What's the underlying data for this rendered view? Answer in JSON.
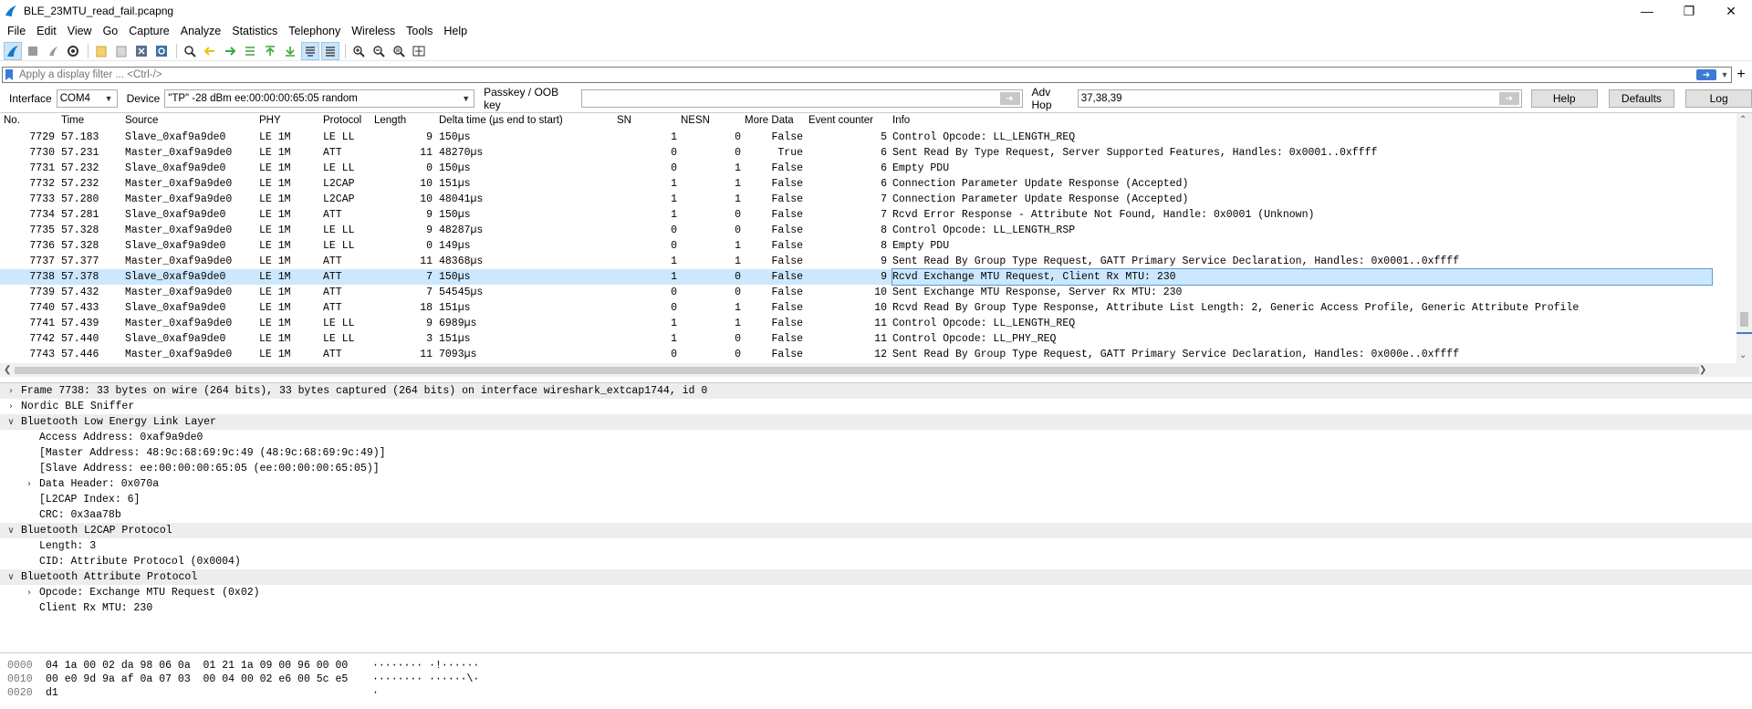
{
  "window": {
    "title": "BLE_23MTU_read_fail.pcapng"
  },
  "menu": [
    "File",
    "Edit",
    "View",
    "Go",
    "Capture",
    "Analyze",
    "Statistics",
    "Telephony",
    "Wireless",
    "Tools",
    "Help"
  ],
  "filter": {
    "placeholder": "Apply a display filter ... <Ctrl-/>"
  },
  "interface_bar": {
    "interface_label": "Interface",
    "interface_value": "COM4",
    "device_label": "Device",
    "device_value": "\"TP\" -28 dBm  ee:00:00:00:65:05  random",
    "passkey_label": "Passkey / OOB key",
    "passkey_value": "",
    "advhop_label": "Adv Hop",
    "advhop_value": "37,38,39",
    "help_button": "Help",
    "defaults_button": "Defaults",
    "log_button": "Log"
  },
  "packet_list": {
    "columns": [
      "No.",
      "Time",
      "Source",
      "PHY",
      "Protocol",
      "Length",
      "Delta time (µs end to start)",
      "SN",
      "NESN",
      "More Data",
      "Event counter",
      "Info"
    ],
    "rows": [
      {
        "no": "7729",
        "time": "57.183",
        "source": "Slave_0xaf9a9de0",
        "phy": "LE 1M",
        "protocol": "LE LL",
        "length": "9",
        "delta": "150µs",
        "sn": "1",
        "nesn": "0",
        "more": "False",
        "event": "5",
        "info": "Control Opcode: LL_LENGTH_REQ"
      },
      {
        "no": "7730",
        "time": "57.231",
        "source": "Master_0xaf9a9de0",
        "phy": "LE 1M",
        "protocol": "ATT",
        "length": "11",
        "delta": "48270µs",
        "sn": "0",
        "nesn": "0",
        "more": "True",
        "event": "6",
        "info": "Sent Read By Type Request, Server Supported Features, Handles: 0x0001..0xffff"
      },
      {
        "no": "7731",
        "time": "57.232",
        "source": "Slave_0xaf9a9de0",
        "phy": "LE 1M",
        "protocol": "LE LL",
        "length": "0",
        "delta": "150µs",
        "sn": "0",
        "nesn": "1",
        "more": "False",
        "event": "6",
        "info": "Empty PDU"
      },
      {
        "no": "7732",
        "time": "57.232",
        "source": "Master_0xaf9a9de0",
        "phy": "LE 1M",
        "protocol": "L2CAP",
        "length": "10",
        "delta": "151µs",
        "sn": "1",
        "nesn": "1",
        "more": "False",
        "event": "6",
        "info": "Connection Parameter Update Response (Accepted)"
      },
      {
        "no": "7733",
        "time": "57.280",
        "source": "Master_0xaf9a9de0",
        "phy": "LE 1M",
        "protocol": "L2CAP",
        "length": "10",
        "delta": "48041µs",
        "sn": "1",
        "nesn": "1",
        "more": "False",
        "event": "7",
        "info": "Connection Parameter Update Response (Accepted)"
      },
      {
        "no": "7734",
        "time": "57.281",
        "source": "Slave_0xaf9a9de0",
        "phy": "LE 1M",
        "protocol": "ATT",
        "length": "9",
        "delta": "150µs",
        "sn": "1",
        "nesn": "0",
        "more": "False",
        "event": "7",
        "info": "Rcvd Error Response - Attribute Not Found, Handle: 0x0001 (Unknown)"
      },
      {
        "no": "7735",
        "time": "57.328",
        "source": "Master_0xaf9a9de0",
        "phy": "LE 1M",
        "protocol": "LE LL",
        "length": "9",
        "delta": "48287µs",
        "sn": "0",
        "nesn": "0",
        "more": "False",
        "event": "8",
        "info": "Control Opcode: LL_LENGTH_RSP"
      },
      {
        "no": "7736",
        "time": "57.328",
        "source": "Slave_0xaf9a9de0",
        "phy": "LE 1M",
        "protocol": "LE LL",
        "length": "0",
        "delta": "149µs",
        "sn": "0",
        "nesn": "1",
        "more": "False",
        "event": "8",
        "info": "Empty PDU"
      },
      {
        "no": "7737",
        "time": "57.377",
        "source": "Master_0xaf9a9de0",
        "phy": "LE 1M",
        "protocol": "ATT",
        "length": "11",
        "delta": "48368µs",
        "sn": "1",
        "nesn": "1",
        "more": "False",
        "event": "9",
        "info": "Sent Read By Group Type Request, GATT Primary Service Declaration, Handles: 0x0001..0xffff"
      },
      {
        "no": "7738",
        "time": "57.378",
        "source": "Slave_0xaf9a9de0",
        "phy": "LE 1M",
        "protocol": "ATT",
        "length": "7",
        "delta": "150µs",
        "sn": "1",
        "nesn": "0",
        "more": "False",
        "event": "9",
        "info": "Rcvd Exchange MTU Request, Client Rx MTU: 230"
      },
      {
        "no": "7739",
        "time": "57.432",
        "source": "Master_0xaf9a9de0",
        "phy": "LE 1M",
        "protocol": "ATT",
        "length": "7",
        "delta": "54545µs",
        "sn": "0",
        "nesn": "0",
        "more": "False",
        "event": "10",
        "info": "Sent Exchange MTU Response, Server Rx MTU: 230"
      },
      {
        "no": "7740",
        "time": "57.433",
        "source": "Slave_0xaf9a9de0",
        "phy": "LE 1M",
        "protocol": "ATT",
        "length": "18",
        "delta": "151µs",
        "sn": "0",
        "nesn": "1",
        "more": "False",
        "event": "10",
        "info": "Rcvd Read By Group Type Response, Attribute List Length: 2, Generic Access Profile, Generic Attribute Profile"
      },
      {
        "no": "7741",
        "time": "57.439",
        "source": "Master_0xaf9a9de0",
        "phy": "LE 1M",
        "protocol": "LE LL",
        "length": "9",
        "delta": "6989µs",
        "sn": "1",
        "nesn": "1",
        "more": "False",
        "event": "11",
        "info": "Control Opcode: LL_LENGTH_REQ"
      },
      {
        "no": "7742",
        "time": "57.440",
        "source": "Slave_0xaf9a9de0",
        "phy": "LE 1M",
        "protocol": "LE LL",
        "length": "3",
        "delta": "151µs",
        "sn": "1",
        "nesn": "0",
        "more": "False",
        "event": "11",
        "info": "Control Opcode: LL_PHY_REQ"
      },
      {
        "no": "7743",
        "time": "57.446",
        "source": "Master_0xaf9a9de0",
        "phy": "LE 1M",
        "protocol": "ATT",
        "length": "11",
        "delta": "7093µs",
        "sn": "0",
        "nesn": "0",
        "more": "False",
        "event": "12",
        "info": "Sent Read By Group Type Request, GATT Primary Service Declaration, Handles: 0x000e..0xffff"
      }
    ]
  },
  "details": [
    {
      "level": 0,
      "toggle": "collapsed",
      "section": true,
      "text": "Frame 7738: 33 bytes on wire (264 bits), 33 bytes captured (264 bits) on interface wireshark_extcap1744, id 0"
    },
    {
      "level": 0,
      "toggle": "collapsed",
      "section": false,
      "text": "Nordic BLE Sniffer"
    },
    {
      "level": 0,
      "toggle": "expanded",
      "section": true,
      "text": "Bluetooth Low Energy Link Layer"
    },
    {
      "level": 1,
      "toggle": "none",
      "section": false,
      "text": "Access Address: 0xaf9a9de0"
    },
    {
      "level": 1,
      "toggle": "none",
      "section": false,
      "text": "[Master Address: 48:9c:68:69:9c:49 (48:9c:68:69:9c:49)]"
    },
    {
      "level": 1,
      "toggle": "none",
      "section": false,
      "text": "[Slave Address: ee:00:00:00:65:05 (ee:00:00:00:65:05)]"
    },
    {
      "level": 1,
      "toggle": "collapsed",
      "section": false,
      "text": "Data Header: 0x070a"
    },
    {
      "level": 1,
      "toggle": "none",
      "section": false,
      "text": "[L2CAP Index: 6]"
    },
    {
      "level": 1,
      "toggle": "none",
      "section": false,
      "text": "CRC: 0x3aa78b"
    },
    {
      "level": 0,
      "toggle": "expanded",
      "section": true,
      "text": "Bluetooth L2CAP Protocol"
    },
    {
      "level": 1,
      "toggle": "none",
      "section": false,
      "text": "Length: 3"
    },
    {
      "level": 1,
      "toggle": "none",
      "section": false,
      "text": "CID: Attribute Protocol (0x0004)"
    },
    {
      "level": 0,
      "toggle": "expanded",
      "section": true,
      "text": "Bluetooth Attribute Protocol"
    },
    {
      "level": 1,
      "toggle": "collapsed",
      "section": false,
      "text": "Opcode: Exchange MTU Request (0x02)"
    },
    {
      "level": 1,
      "toggle": "none",
      "section": false,
      "text": "Client Rx MTU: 230"
    }
  ],
  "bytes": [
    {
      "offset": "0000",
      "hex": "04 1a 00 02 da 98 06 0a  01 21 1a 09 00 96 00 00",
      "ascii": "········ ·!······"
    },
    {
      "offset": "0010",
      "hex": "00 e0 9d 9a af 0a 07 03  00 04 00 02 e6 00 5c e5",
      "ascii": "········ ······\\·"
    },
    {
      "offset": "0020",
      "hex": "d1",
      "ascii": "·"
    }
  ]
}
